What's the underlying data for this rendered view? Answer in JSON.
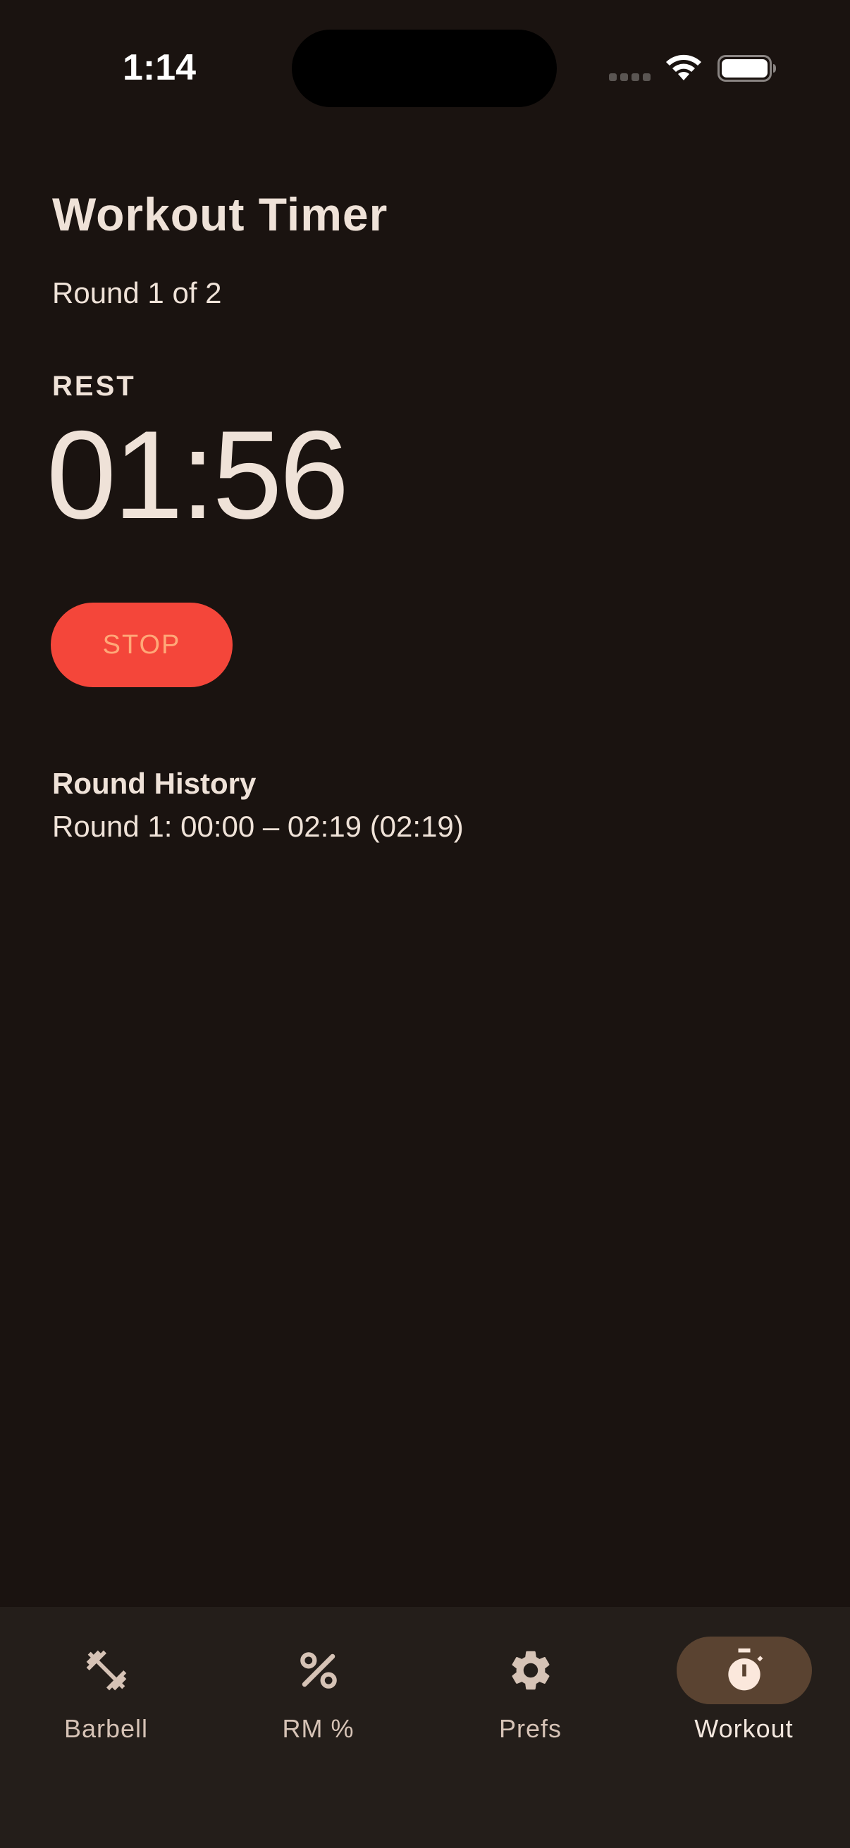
{
  "status_bar": {
    "time": "1:14"
  },
  "header": {
    "title": "Workout Timer",
    "round_indicator": "Round 1 of 2"
  },
  "timer": {
    "phase": "REST",
    "display": "01:56"
  },
  "controls": {
    "stop_label": "STOP"
  },
  "history": {
    "title": "Round History",
    "entries": [
      "Round 1: 00:00 – 02:19 (02:19)"
    ]
  },
  "nav": {
    "items": [
      {
        "label": "Barbell",
        "icon": "barbell-icon",
        "active": false
      },
      {
        "label": "RM %",
        "icon": "percent-icon",
        "active": false
      },
      {
        "label": "Prefs",
        "icon": "gear-icon",
        "active": false
      },
      {
        "label": "Workout",
        "icon": "stopwatch-icon",
        "active": true
      }
    ]
  },
  "colors": {
    "background": "#1a1310",
    "stop_button": "#f4463a",
    "stop_text": "#ffa878",
    "nav_background": "#241e1a",
    "nav_active_pill": "#5a4331",
    "text": "#efe2d8"
  }
}
